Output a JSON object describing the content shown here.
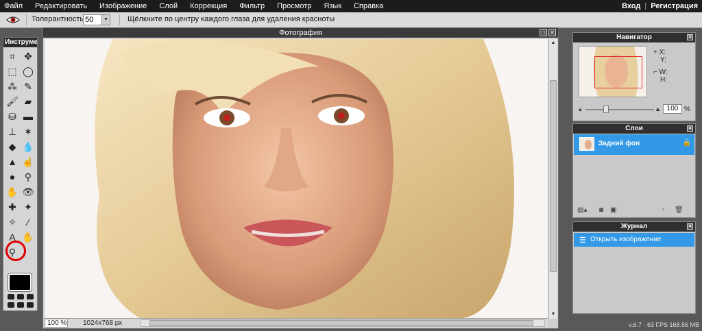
{
  "menubar": {
    "items": [
      "Файл",
      "Редактировать",
      "Изображение",
      "Слой",
      "Коррекция",
      "Фильтр",
      "Просмотр",
      "Язык",
      "Справка"
    ],
    "login": "Вход",
    "register": "Регистрация"
  },
  "options": {
    "tolerance_label": "Толерантность:",
    "tolerance_value": "50",
    "hint": "Щёлкните по центру каждого глаза для удаления красноты"
  },
  "toolbox": {
    "title": "Инструменты",
    "tools": [
      {
        "name": "crop-icon",
        "glyph": "⌗"
      },
      {
        "name": "move-icon",
        "glyph": "✥"
      },
      {
        "name": "marquee-icon",
        "glyph": "⬚"
      },
      {
        "name": "lasso-icon",
        "glyph": "◯"
      },
      {
        "name": "magic-wand-icon",
        "glyph": "⁂"
      },
      {
        "name": "pencil-icon",
        "glyph": "✎"
      },
      {
        "name": "brush-icon",
        "glyph": "🖌"
      },
      {
        "name": "eraser-icon",
        "glyph": "▰"
      },
      {
        "name": "bucket-icon",
        "glyph": "⛁"
      },
      {
        "name": "gradient-icon",
        "glyph": "▬"
      },
      {
        "name": "stamp-icon",
        "glyph": "⊥"
      },
      {
        "name": "color-replace-icon",
        "glyph": "✶"
      },
      {
        "name": "shape-icon",
        "glyph": "◆"
      },
      {
        "name": "blur-icon",
        "glyph": "💧"
      },
      {
        "name": "sharpen-icon",
        "glyph": "▲"
      },
      {
        "name": "smudge-icon",
        "glyph": "☝"
      },
      {
        "name": "sponge-icon",
        "glyph": "●"
      },
      {
        "name": "dodge-icon",
        "glyph": "⚲"
      },
      {
        "name": "burn-icon",
        "glyph": "✋"
      },
      {
        "name": "red-eye-icon",
        "glyph": "👁"
      },
      {
        "name": "spot-heal-icon",
        "glyph": "✚"
      },
      {
        "name": "bloat-icon",
        "glyph": "✦"
      },
      {
        "name": "pinch-icon",
        "glyph": "✧"
      },
      {
        "name": "picker-icon",
        "glyph": "⁄"
      },
      {
        "name": "type-icon",
        "glyph": "A"
      },
      {
        "name": "hand-icon",
        "glyph": "✋"
      },
      {
        "name": "zoom-icon",
        "glyph": "⚲"
      }
    ],
    "foreground_color": "#000000"
  },
  "photo": {
    "title": "Фотография",
    "zoom": "100",
    "zoom_unit": "%",
    "dimensions": "1024x768 px"
  },
  "navigator": {
    "title": "Навигатор",
    "x_label": "X:",
    "y_label": "Y:",
    "w_label": "W:",
    "h_label": "H:",
    "zoom": "100",
    "zoom_unit": "%",
    "zoom_fraction": 0.3
  },
  "layers": {
    "title": "Слои",
    "items": [
      {
        "name": "Задний фон",
        "locked": true
      }
    ]
  },
  "history": {
    "title": "Журнал",
    "items": [
      {
        "label": "Открыть изображение"
      }
    ]
  },
  "version": "v.6.7 - 63 FPS 168.56 MB",
  "colors": {
    "accent": "#3399e6",
    "menubar": "#1c1c1c",
    "highlight_circle": "#e00000"
  }
}
